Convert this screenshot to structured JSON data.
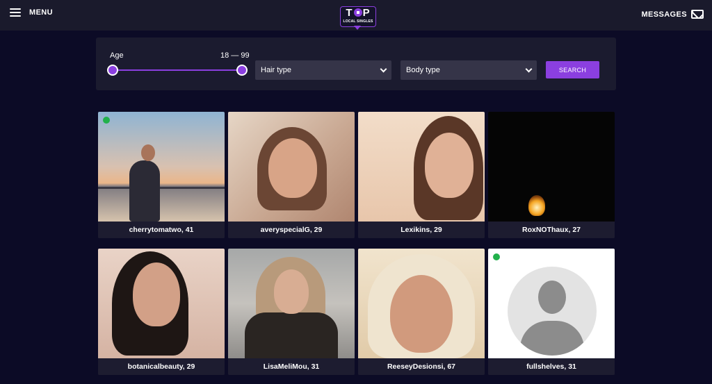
{
  "header": {
    "menu_label": "MENU",
    "logo_top": "T P",
    "logo_sub": "LOCAL SINGLES",
    "messages_label": "MESSAGES"
  },
  "filters": {
    "age_label": "Age",
    "age_range": "18 — 99",
    "age_min": 18,
    "age_max": 99,
    "hair_type": "Hair type",
    "body_type": "Body type",
    "search_label": "SEARCH"
  },
  "profiles": [
    {
      "caption": "cherrytomatwo, 41",
      "online": true
    },
    {
      "caption": "averyspecialG, 29",
      "online": false
    },
    {
      "caption": "Lexikins, 29",
      "online": false
    },
    {
      "caption": "RoxNOThaux, 27",
      "online": false
    },
    {
      "caption": "botanicalbeauty, 29",
      "online": false
    },
    {
      "caption": "LisaMeliMou, 31",
      "online": false
    },
    {
      "caption": "ReeseyDesionsi, 67",
      "online": false
    },
    {
      "caption": "fullshelves, 31",
      "online": true
    }
  ],
  "colors": {
    "accent": "#8b3fe0",
    "online": "#22b14c",
    "background": "#0c0b26"
  }
}
